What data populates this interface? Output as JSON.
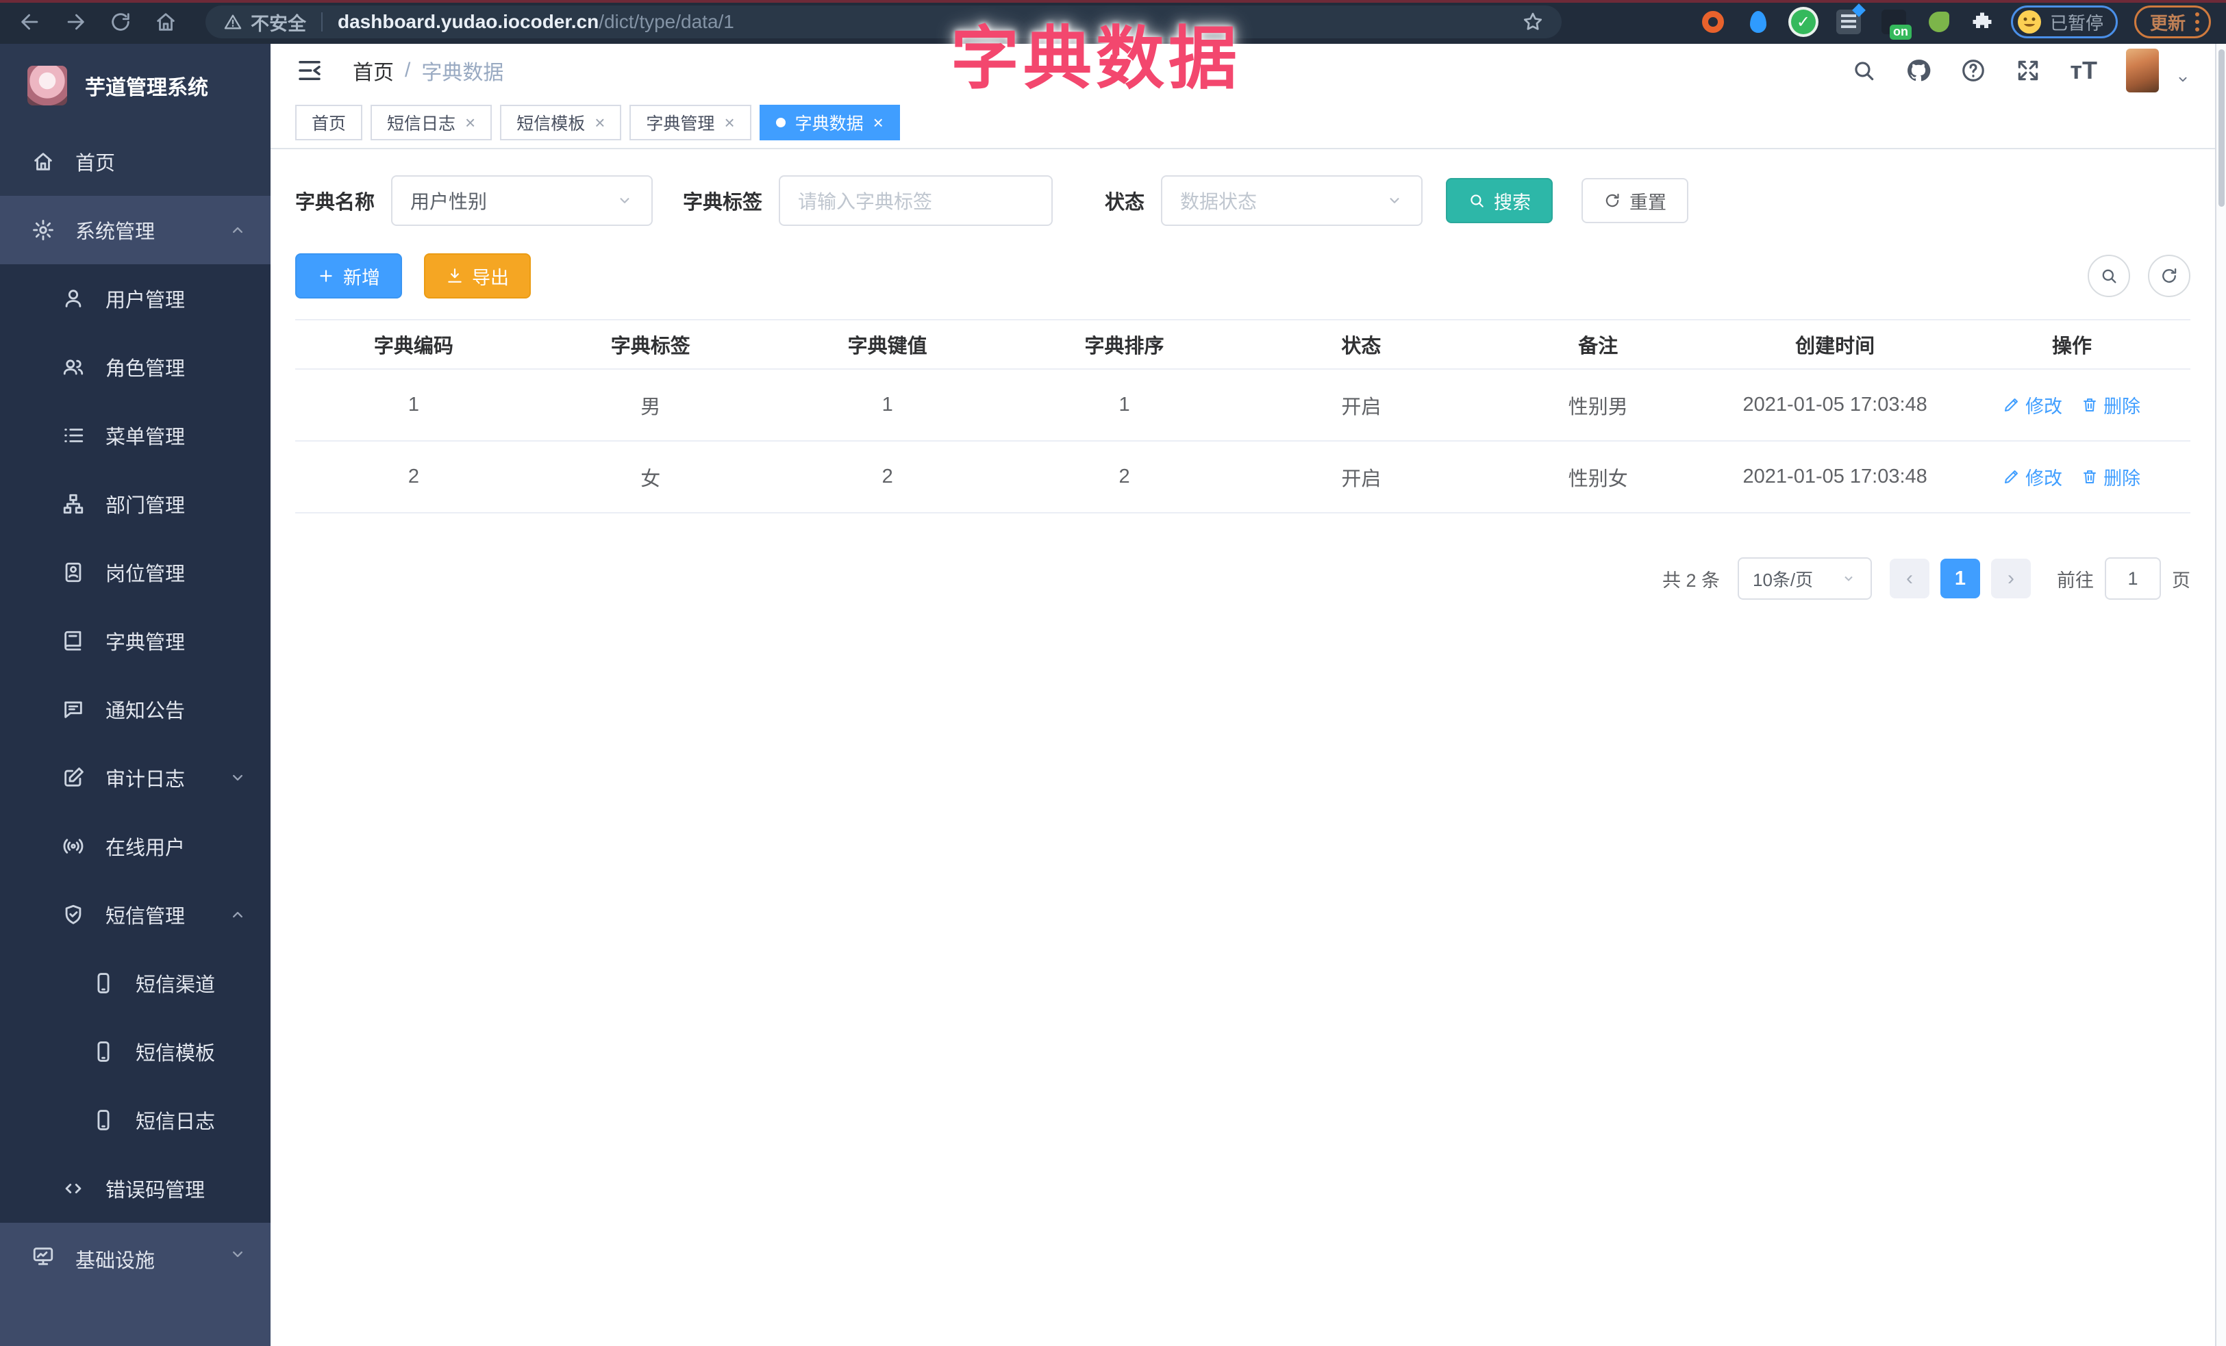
{
  "browser": {
    "security_label": "不安全",
    "url_host": "dashboard.yudao.iocoder.cn",
    "url_path": "/dict/type/data/1",
    "extension_on_badge": "on",
    "paused_badge": "已暂停",
    "update_button": "更新"
  },
  "overlay_title": "字典数据",
  "sidebar": {
    "app_title": "芋道管理系统",
    "items": [
      {
        "id": "home",
        "label": "首页",
        "icon": "home",
        "level": 1
      },
      {
        "id": "system",
        "label": "系统管理",
        "icon": "gear",
        "level": 1,
        "caret": "up",
        "highlighted": true
      },
      {
        "id": "user",
        "label": "用户管理",
        "icon": "user",
        "level": 2
      },
      {
        "id": "role",
        "label": "角色管理",
        "icon": "users",
        "level": 2
      },
      {
        "id": "menu",
        "label": "菜单管理",
        "icon": "list",
        "level": 2
      },
      {
        "id": "dept",
        "label": "部门管理",
        "icon": "tree",
        "level": 2
      },
      {
        "id": "post",
        "label": "岗位管理",
        "icon": "badge",
        "level": 2
      },
      {
        "id": "dict",
        "label": "字典管理",
        "icon": "book",
        "level": 2
      },
      {
        "id": "notice",
        "label": "通知公告",
        "icon": "chat",
        "level": 2
      },
      {
        "id": "audit-log",
        "label": "审计日志",
        "icon": "edit",
        "level": 2,
        "caret": "down"
      },
      {
        "id": "online-user",
        "label": "在线用户",
        "icon": "online",
        "level": 2
      },
      {
        "id": "sms",
        "label": "短信管理",
        "icon": "shield",
        "level": 2,
        "caret": "up"
      },
      {
        "id": "sms-channel",
        "label": "短信渠道",
        "icon": "phone",
        "level": 3
      },
      {
        "id": "sms-template",
        "label": "短信模板",
        "icon": "phone",
        "level": 3
      },
      {
        "id": "sms-log",
        "label": "短信日志",
        "icon": "phone",
        "level": 3
      },
      {
        "id": "errcode",
        "label": "错误码管理",
        "icon": "code",
        "level": 2
      },
      {
        "id": "infra",
        "label": "基础设施",
        "icon": "monitor",
        "level": 1,
        "caret": "down",
        "highlighted": true,
        "grow": true
      }
    ]
  },
  "breadcrumb": {
    "home": "首页",
    "separator": "/",
    "current": "字典数据"
  },
  "tabs": [
    {
      "label": "首页",
      "closable": false,
      "active": false
    },
    {
      "label": "短信日志",
      "closable": true,
      "active": false
    },
    {
      "label": "短信模板",
      "closable": true,
      "active": false
    },
    {
      "label": "字典管理",
      "closable": true,
      "active": false
    },
    {
      "label": "字典数据",
      "closable": true,
      "active": true
    }
  ],
  "filters": {
    "dict_name_label": "字典名称",
    "dict_name_value": "用户性别",
    "dict_label_label": "字典标签",
    "dict_label_placeholder": "请输入字典标签",
    "status_label": "状态",
    "status_placeholder": "数据状态",
    "search_button": "搜索",
    "reset_button": "重置"
  },
  "toolbar": {
    "add_button": "新增",
    "export_button": "导出"
  },
  "table": {
    "headers": [
      "字典编码",
      "字典标签",
      "字典键值",
      "字典排序",
      "状态",
      "备注",
      "创建时间",
      "操作"
    ],
    "rows": [
      {
        "code": "1",
        "label": "男",
        "value": "1",
        "sort": "1",
        "status": "开启",
        "remark": "性别男",
        "created": "2021-01-05 17:03:48"
      },
      {
        "code": "2",
        "label": "女",
        "value": "2",
        "sort": "2",
        "status": "开启",
        "remark": "性别女",
        "created": "2021-01-05 17:03:48"
      }
    ],
    "edit_label": "修改",
    "delete_label": "删除"
  },
  "pagination": {
    "total": "共 2 条",
    "page_size": "10条/页",
    "current_page": "1",
    "goto_label": "前往",
    "goto_value": "1",
    "page_unit": "页"
  },
  "colors": {
    "accent": "#409eff",
    "success": "#2db7a8",
    "warning": "#f5a623",
    "annotation": "#f3476e"
  }
}
